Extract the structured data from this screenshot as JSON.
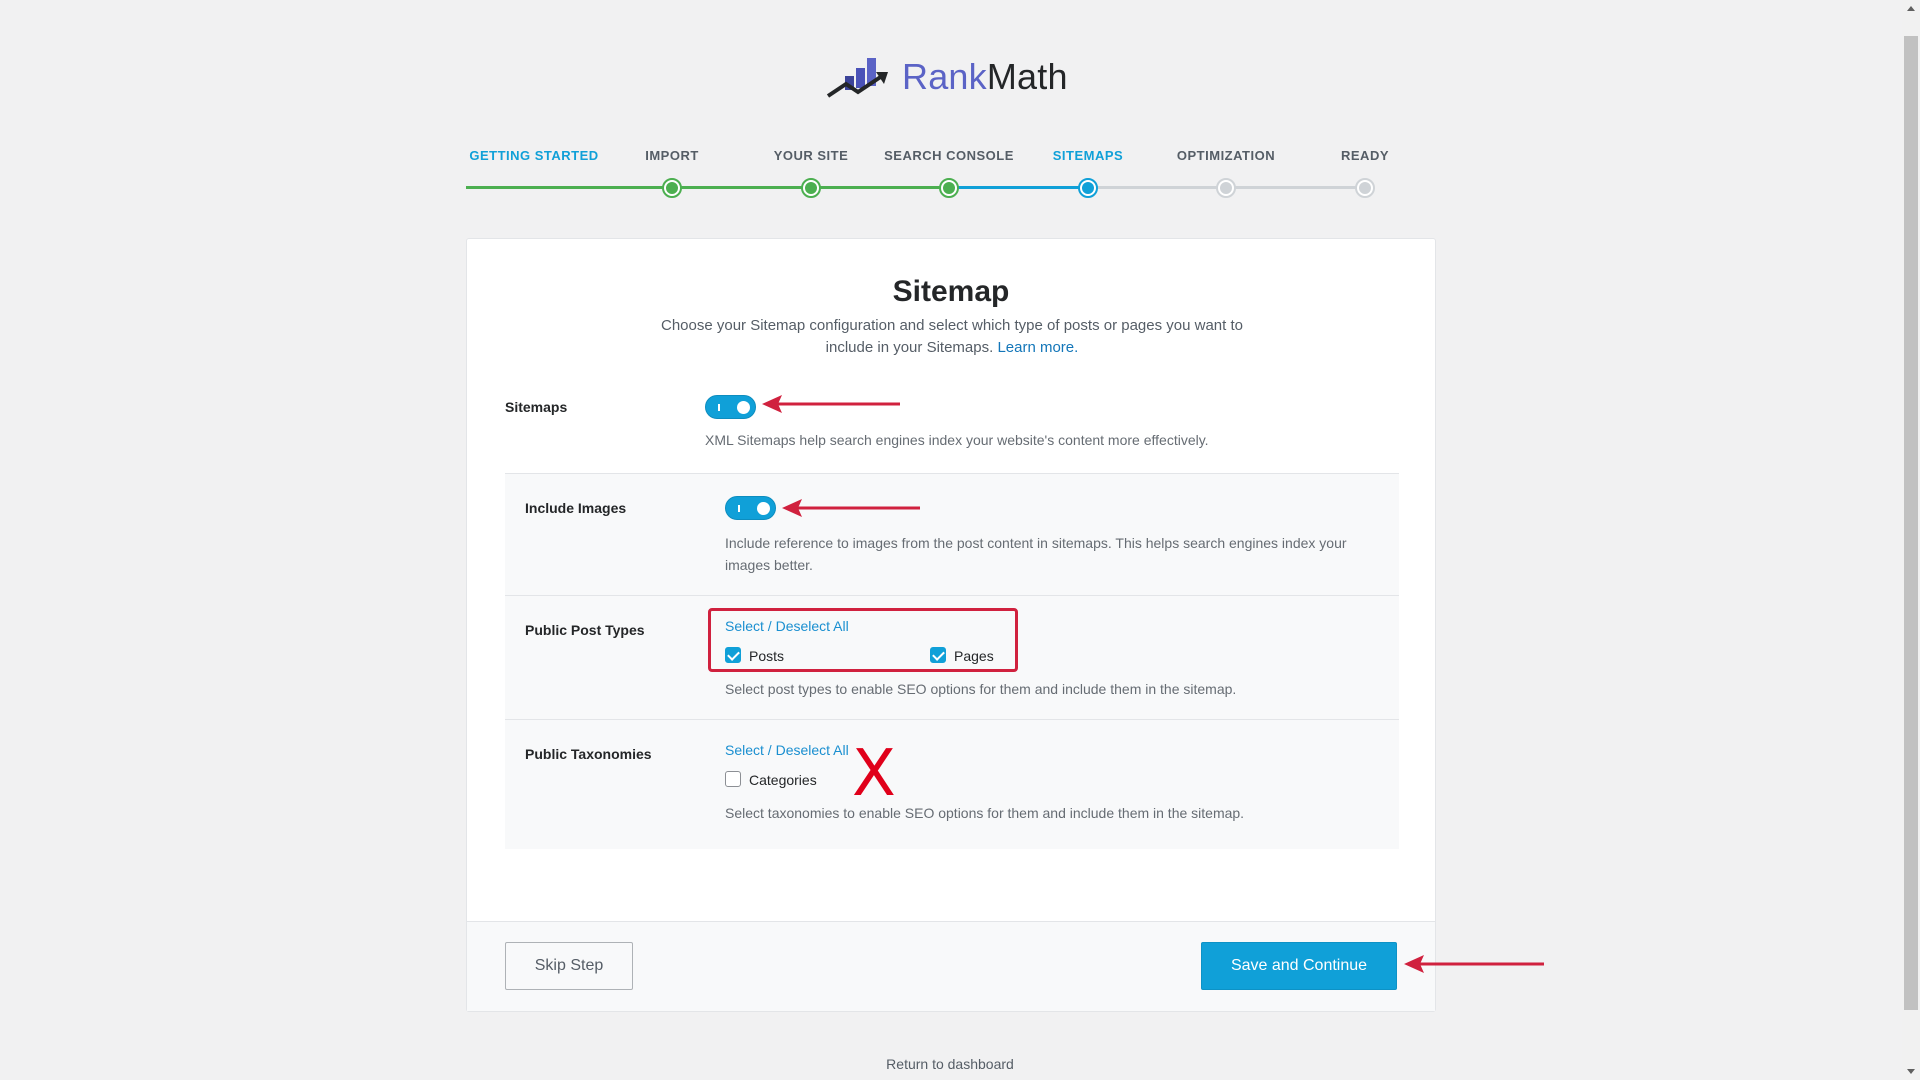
{
  "logo": {
    "part1": "Rank",
    "part2": "Math"
  },
  "steps": [
    {
      "label": "GETTING STARTED",
      "state": "active"
    },
    {
      "label": "IMPORT",
      "state": "done"
    },
    {
      "label": "YOUR SITE",
      "state": "done"
    },
    {
      "label": "SEARCH CONSOLE",
      "state": "done"
    },
    {
      "label": "SITEMAPS",
      "state": "current"
    },
    {
      "label": "OPTIMIZATION",
      "state": "todo"
    },
    {
      "label": "READY",
      "state": "todo"
    }
  ],
  "card": {
    "title": "Sitemap",
    "description": "Choose your Sitemap configuration and select which type of posts or pages you want to include in your Sitemaps.",
    "learn_more": "Learn more."
  },
  "sitemaps": {
    "label": "Sitemaps",
    "enabled": true,
    "help": "XML Sitemaps help search engines index your website's content more effectively."
  },
  "include_images": {
    "label": "Include Images",
    "enabled": true,
    "help": "Include reference to images from the post content in sitemaps. This helps search engines index your images better."
  },
  "post_types": {
    "label": "Public Post Types",
    "select_all": "Select / Deselect All",
    "options": [
      {
        "label": "Posts",
        "checked": true
      },
      {
        "label": "Pages",
        "checked": true
      }
    ],
    "help": "Select post types to enable SEO options for them and include them in the sitemap."
  },
  "taxonomies": {
    "label": "Public Taxonomies",
    "select_all": "Select / Deselect All",
    "options": [
      {
        "label": "Categories",
        "checked": false
      }
    ],
    "help": "Select taxonomies to enable SEO options for them and include them in the sitemap.",
    "annotation": "X"
  },
  "footer": {
    "skip": "Skip Step",
    "save": "Save and Continue"
  },
  "return_link": "Return to dashboard",
  "colors": {
    "accent": "#10a0d8",
    "done": "#4caf50",
    "annotation": "#d0213e"
  }
}
